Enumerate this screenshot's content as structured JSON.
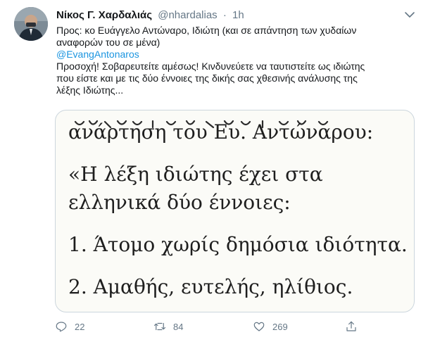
{
  "tweet": {
    "author_name": "Νίκος Γ. Χαρδαλιάς",
    "handle": "@nhardalias",
    "separator": "·",
    "time": "1h",
    "text_line1": "Προς: κο Ευάγγελο Αντώναρο, Ιδιώτη (και σε απάντηση των χυδαίων",
    "text_line2": "αναφορών του σε μένα)",
    "mention": "@EvangAntonaros",
    "text_line3": "Προσοχή! Σοβαρευτείτε αμέσως! Κινδυνεύετε να ταυτιστείτε ως ιδιώτης",
    "text_line4": "που είστε και με τις δύο έννοιες της δικής σας χθεσινής ανάλυσης της",
    "text_line5": "λέξης Ιδιώτης..."
  },
  "media": {
    "line1": "ανάρτηση του Ευ. Αντώναρου:",
    "line2": "«Η λέξη ιδιώτης έχει στα",
    "line3": "ελληνικά δύο έννοιες:",
    "line4": "1. Άτομο χωρίς δημόσια ιδιότητα.",
    "line5": "2. Αμαθής, ευτελής, ηλίθιος."
  },
  "actions": {
    "reply_count": "22",
    "retweet_count": "84",
    "like_count": "269"
  },
  "colors": {
    "link": "#1b95e0",
    "secondary_text": "#657786",
    "border": "#ccd6dd"
  }
}
